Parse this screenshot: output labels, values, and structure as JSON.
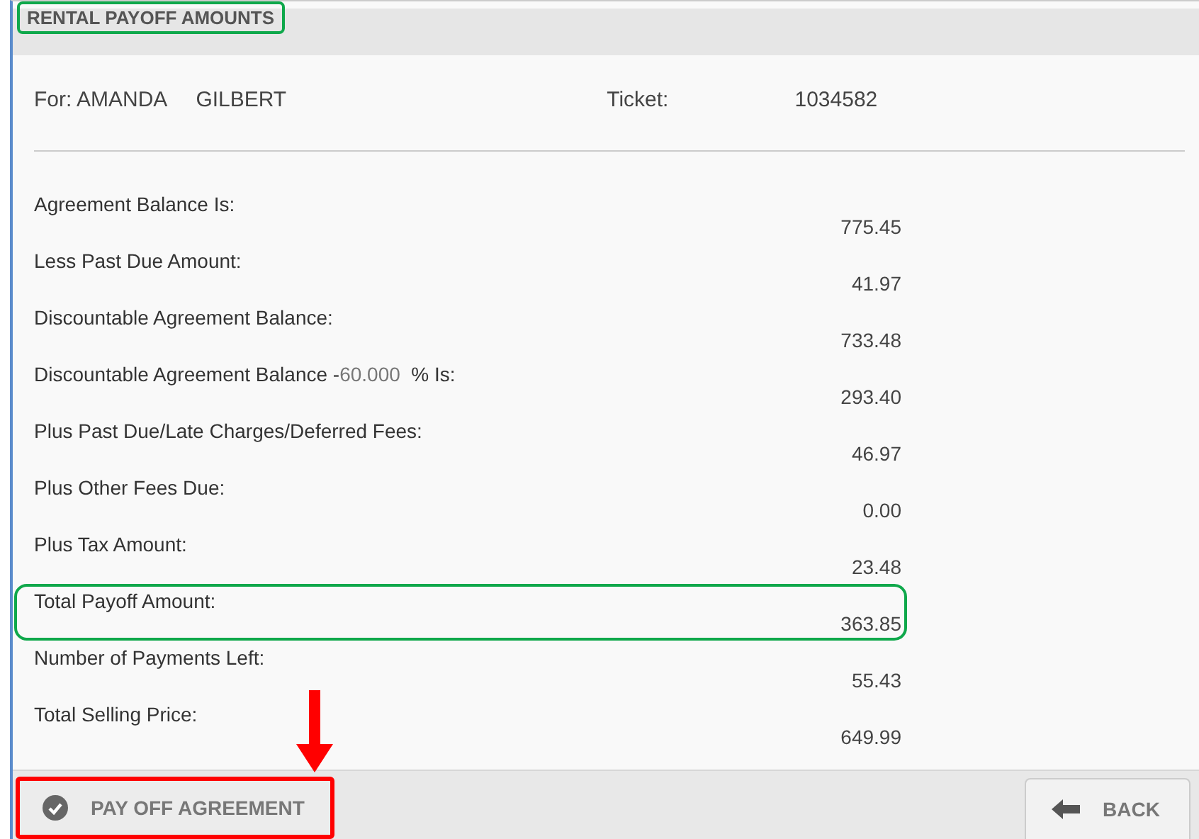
{
  "title": {
    "text": "RENTAL PAYOFF AMOUNTS",
    "highlighted": true
  },
  "customer": {
    "label": "For: AMANDA",
    "last_name": "GILBERT",
    "ticket_label": "Ticket:",
    "ticket": "1034582"
  },
  "rows": [
    {
      "label": "Agreement Balance Is:",
      "value": "775.45",
      "highlighted": false
    },
    {
      "label": "Less Past Due Amount:",
      "value": "41.97",
      "highlighted": false
    },
    {
      "label": "Discountable Agreement Balance:",
      "value": "733.48",
      "highlighted": false
    },
    {
      "label": "Discountable Agreement Balance -",
      "rate": "60.000",
      "suffix": "% Is:",
      "value": "293.40",
      "highlighted": false
    },
    {
      "label": "Plus Past Due/Late Charges/Deferred Fees:",
      "value": "46.97",
      "highlighted": false
    },
    {
      "label": "Plus Other Fees Due:",
      "value": "0.00",
      "highlighted": false
    },
    {
      "label": "Plus Tax Amount:",
      "value": "23.48",
      "highlighted": false
    },
    {
      "label": "Total Payoff Amount:",
      "value": "363.85",
      "highlighted": true
    },
    {
      "label": "Number of Payments Left:",
      "value": "55.43",
      "highlighted": false
    },
    {
      "label": "Total Selling Price:",
      "value": "649.99",
      "highlighted": false
    }
  ],
  "buttons": [
    {
      "kind": "confirm",
      "label": "PAY OFF AGREEMENT",
      "highlighted": true
    },
    {
      "kind": "back",
      "label": "BACK",
      "highlighted": false
    }
  ]
}
